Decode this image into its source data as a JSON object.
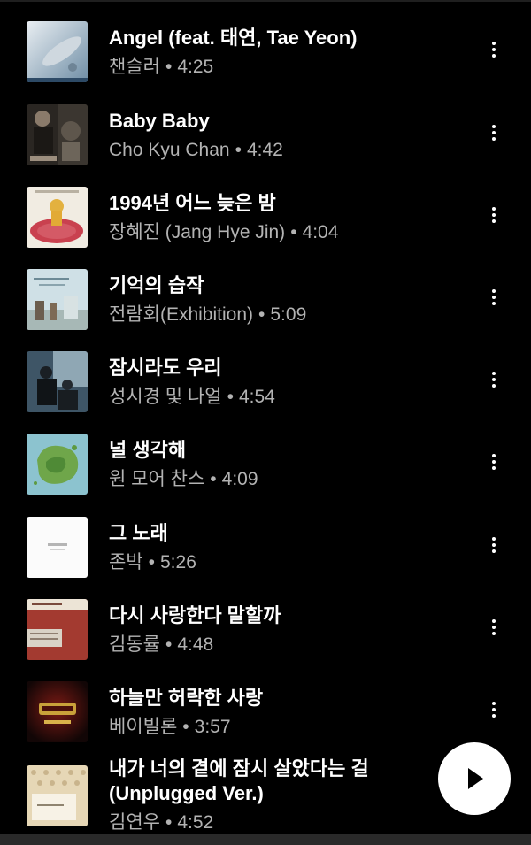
{
  "tracks": [
    {
      "title": "Angel (feat. 태연, Tae Yeon)",
      "artist": "챈슬러",
      "duration": "4:25",
      "art": "angel-cover"
    },
    {
      "title": "Baby Baby",
      "artist": "Cho Kyu Chan",
      "duration": "4:42",
      "art": "baby-baby-cover"
    },
    {
      "title": "1994년 어느 늦은 밤",
      "artist": "장혜진 (Jang Hye Jin)",
      "duration": "4:04",
      "art": "1994-cover"
    },
    {
      "title": "기억의 습작",
      "artist": "전람회(Exhibition)",
      "duration": "5:09",
      "art": "memory-cover"
    },
    {
      "title": "잠시라도 우리",
      "artist": "성시경 및 나얼",
      "duration": "4:54",
      "art": "jamsi-cover"
    },
    {
      "title": "널 생각해",
      "artist": "원 모어 찬스",
      "duration": "4:09",
      "art": "island-cover"
    },
    {
      "title": "그 노래",
      "artist": "존박",
      "duration": "5:26",
      "art": "white-cover"
    },
    {
      "title": "다시 사랑한다 말할까",
      "artist": "김동률",
      "duration": "4:48",
      "art": "kdr-cover"
    },
    {
      "title": "하늘만 허락한 사랑",
      "artist": "베이빌론",
      "duration": "3:57",
      "art": "episode7-cover"
    },
    {
      "title": "내가 너의 곁에 잠시 살았다는 걸",
      "title_line2": "(Unplugged Ver.)",
      "artist": "김연우",
      "duration": "4:52",
      "art": "unplugged-cover"
    }
  ],
  "separator": "•",
  "icons": {
    "more": "more-vertical-icon",
    "play": "play-icon"
  },
  "colors": {
    "background": "#000000",
    "title": "#ffffff",
    "subtitle": "#b3b3b3",
    "fab": "#ffffff"
  }
}
